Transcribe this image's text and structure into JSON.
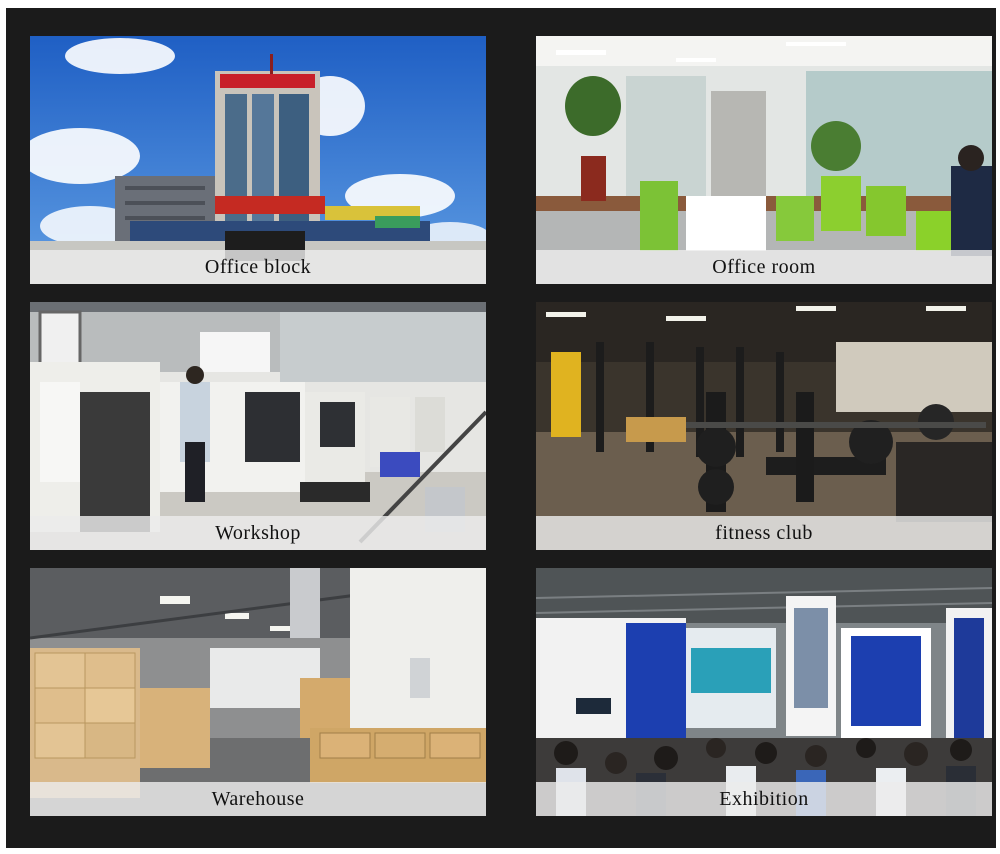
{
  "tiles": [
    {
      "id": "office-block",
      "caption": "Office block"
    },
    {
      "id": "office-room",
      "caption": "Office room"
    },
    {
      "id": "workshop",
      "caption": "Workshop"
    },
    {
      "id": "fitness-club",
      "caption": "fitness club"
    },
    {
      "id": "warehouse",
      "caption": "Warehouse"
    },
    {
      "id": "exhibition",
      "caption": "Exhibition"
    }
  ],
  "colors": {
    "frame": "#1b1b1b",
    "caption_bg": "#ebebeb",
    "sky": "#2f6fc9",
    "chair_green": "#8bd12a",
    "booth_blue": "#1c3fb0"
  }
}
